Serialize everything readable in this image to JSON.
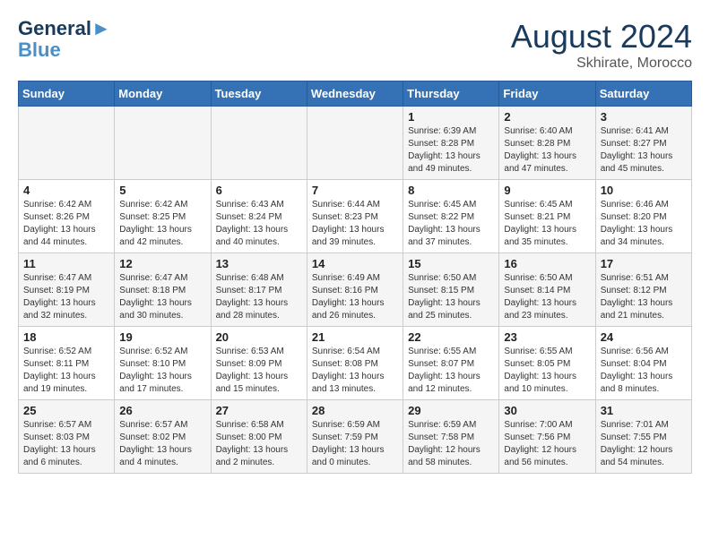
{
  "header": {
    "logo_line1": "General",
    "logo_line2": "Blue",
    "month": "August 2024",
    "location": "Skhirate, Morocco"
  },
  "weekdays": [
    "Sunday",
    "Monday",
    "Tuesday",
    "Wednesday",
    "Thursday",
    "Friday",
    "Saturday"
  ],
  "weeks": [
    [
      {
        "day": "",
        "info": ""
      },
      {
        "day": "",
        "info": ""
      },
      {
        "day": "",
        "info": ""
      },
      {
        "day": "",
        "info": ""
      },
      {
        "day": "1",
        "info": "Sunrise: 6:39 AM\nSunset: 8:28 PM\nDaylight: 13 hours and 49 minutes."
      },
      {
        "day": "2",
        "info": "Sunrise: 6:40 AM\nSunset: 8:28 PM\nDaylight: 13 hours and 47 minutes."
      },
      {
        "day": "3",
        "info": "Sunrise: 6:41 AM\nSunset: 8:27 PM\nDaylight: 13 hours and 45 minutes."
      }
    ],
    [
      {
        "day": "4",
        "info": "Sunrise: 6:42 AM\nSunset: 8:26 PM\nDaylight: 13 hours and 44 minutes."
      },
      {
        "day": "5",
        "info": "Sunrise: 6:42 AM\nSunset: 8:25 PM\nDaylight: 13 hours and 42 minutes."
      },
      {
        "day": "6",
        "info": "Sunrise: 6:43 AM\nSunset: 8:24 PM\nDaylight: 13 hours and 40 minutes."
      },
      {
        "day": "7",
        "info": "Sunrise: 6:44 AM\nSunset: 8:23 PM\nDaylight: 13 hours and 39 minutes."
      },
      {
        "day": "8",
        "info": "Sunrise: 6:45 AM\nSunset: 8:22 PM\nDaylight: 13 hours and 37 minutes."
      },
      {
        "day": "9",
        "info": "Sunrise: 6:45 AM\nSunset: 8:21 PM\nDaylight: 13 hours and 35 minutes."
      },
      {
        "day": "10",
        "info": "Sunrise: 6:46 AM\nSunset: 8:20 PM\nDaylight: 13 hours and 34 minutes."
      }
    ],
    [
      {
        "day": "11",
        "info": "Sunrise: 6:47 AM\nSunset: 8:19 PM\nDaylight: 13 hours and 32 minutes."
      },
      {
        "day": "12",
        "info": "Sunrise: 6:47 AM\nSunset: 8:18 PM\nDaylight: 13 hours and 30 minutes."
      },
      {
        "day": "13",
        "info": "Sunrise: 6:48 AM\nSunset: 8:17 PM\nDaylight: 13 hours and 28 minutes."
      },
      {
        "day": "14",
        "info": "Sunrise: 6:49 AM\nSunset: 8:16 PM\nDaylight: 13 hours and 26 minutes."
      },
      {
        "day": "15",
        "info": "Sunrise: 6:50 AM\nSunset: 8:15 PM\nDaylight: 13 hours and 25 minutes."
      },
      {
        "day": "16",
        "info": "Sunrise: 6:50 AM\nSunset: 8:14 PM\nDaylight: 13 hours and 23 minutes."
      },
      {
        "day": "17",
        "info": "Sunrise: 6:51 AM\nSunset: 8:12 PM\nDaylight: 13 hours and 21 minutes."
      }
    ],
    [
      {
        "day": "18",
        "info": "Sunrise: 6:52 AM\nSunset: 8:11 PM\nDaylight: 13 hours and 19 minutes."
      },
      {
        "day": "19",
        "info": "Sunrise: 6:52 AM\nSunset: 8:10 PM\nDaylight: 13 hours and 17 minutes."
      },
      {
        "day": "20",
        "info": "Sunrise: 6:53 AM\nSunset: 8:09 PM\nDaylight: 13 hours and 15 minutes."
      },
      {
        "day": "21",
        "info": "Sunrise: 6:54 AM\nSunset: 8:08 PM\nDaylight: 13 hours and 13 minutes."
      },
      {
        "day": "22",
        "info": "Sunrise: 6:55 AM\nSunset: 8:07 PM\nDaylight: 13 hours and 12 minutes."
      },
      {
        "day": "23",
        "info": "Sunrise: 6:55 AM\nSunset: 8:05 PM\nDaylight: 13 hours and 10 minutes."
      },
      {
        "day": "24",
        "info": "Sunrise: 6:56 AM\nSunset: 8:04 PM\nDaylight: 13 hours and 8 minutes."
      }
    ],
    [
      {
        "day": "25",
        "info": "Sunrise: 6:57 AM\nSunset: 8:03 PM\nDaylight: 13 hours and 6 minutes."
      },
      {
        "day": "26",
        "info": "Sunrise: 6:57 AM\nSunset: 8:02 PM\nDaylight: 13 hours and 4 minutes."
      },
      {
        "day": "27",
        "info": "Sunrise: 6:58 AM\nSunset: 8:00 PM\nDaylight: 13 hours and 2 minutes."
      },
      {
        "day": "28",
        "info": "Sunrise: 6:59 AM\nSunset: 7:59 PM\nDaylight: 13 hours and 0 minutes."
      },
      {
        "day": "29",
        "info": "Sunrise: 6:59 AM\nSunset: 7:58 PM\nDaylight: 12 hours and 58 minutes."
      },
      {
        "day": "30",
        "info": "Sunrise: 7:00 AM\nSunset: 7:56 PM\nDaylight: 12 hours and 56 minutes."
      },
      {
        "day": "31",
        "info": "Sunrise: 7:01 AM\nSunset: 7:55 PM\nDaylight: 12 hours and 54 minutes."
      }
    ]
  ]
}
